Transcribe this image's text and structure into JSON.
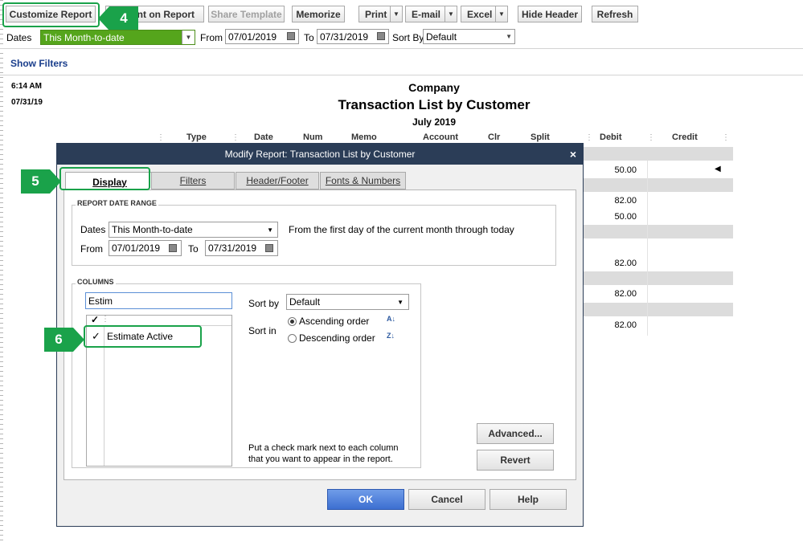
{
  "toolbar": {
    "customize": "Customize Report",
    "comment": "Comment on Report",
    "comment_visible": "ent on Report",
    "share": "Share Template",
    "memorize": "Memorize",
    "print": "Print",
    "email": "E-mail",
    "excel": "Excel",
    "hide_header": "Hide Header",
    "refresh": "Refresh"
  },
  "filter_bar": {
    "dates_label": "Dates",
    "dates_value": "This Month-to-date",
    "from_label": "From",
    "from_value": "07/01/2019",
    "to_label": "To",
    "to_value": "07/31/2019",
    "sort_by_label": "Sort By",
    "sort_by_value": "Default"
  },
  "show_filters": "Show Filters",
  "report": {
    "time": "6:14 AM",
    "date": "07/31/19",
    "company": "Company",
    "title": "Transaction List by Customer",
    "period": "July 2019",
    "columns": [
      "Type",
      "Date",
      "Num",
      "Memo",
      "Account",
      "Clr",
      "Split",
      "Debit",
      "Credit"
    ],
    "debit_values": [
      "50.00",
      "82.00",
      "50.00",
      "82.00",
      "82.00",
      "82.00"
    ]
  },
  "dialog": {
    "title": "Modify Report: Transaction List by Customer",
    "close": "×",
    "tabs": [
      "Display",
      "Filters",
      "Header/Footer",
      "Fonts & Numbers"
    ],
    "report_date_range_title": "REPORT DATE RANGE",
    "dates_label": "Dates",
    "dates_value": "This Month-to-date",
    "dates_desc": "From the first day of the current month through today",
    "from_label": "From",
    "from_value": "07/01/2019",
    "to_label": "To",
    "to_value": "07/31/2019",
    "columns_title": "COLUMNS",
    "search_value": "Estim",
    "check_header": "✓",
    "column_item_check": "✓",
    "column_item": "Estimate Active",
    "sort_by_label": "Sort by",
    "sort_by_value": "Default",
    "sort_in_label": "Sort in",
    "ascending": "Ascending order",
    "descending": "Descending order",
    "hint": "Put a check mark next to each column that you want to appear in the report.",
    "advanced": "Advanced...",
    "revert": "Revert",
    "ok": "OK",
    "cancel": "Cancel",
    "help": "Help"
  },
  "annotations": {
    "step4": "4",
    "step5": "5",
    "step6": "6"
  },
  "colors": {
    "accent_green": "#1aa24a",
    "date_fill": "#55a51c",
    "title_bar": "#2b3d57",
    "ok_blue": "#3d6fd1"
  }
}
